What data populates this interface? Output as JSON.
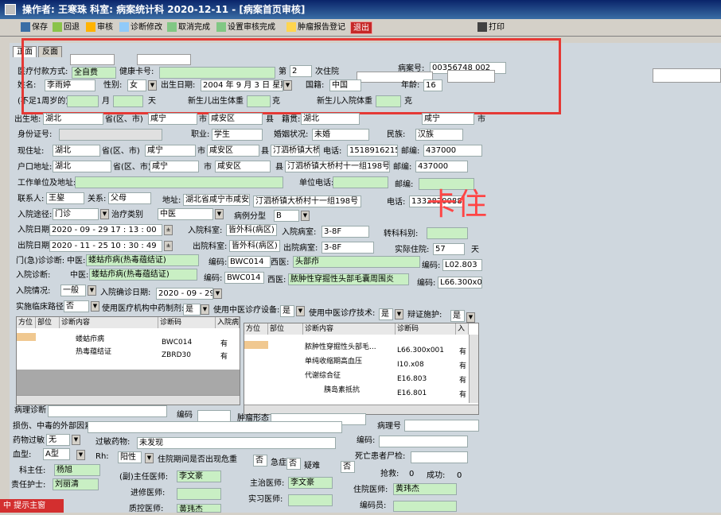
{
  "title": "操作者: 王寒珠   科室: 病案统计科   2020-12-11 - [病案首页审核]",
  "toolbar": {
    "save": "保存",
    "back": "回退",
    "audit": "审核",
    "diag_edit": "诊断修改",
    "cancel_done": "取消完成",
    "set_done": "设置审核完成",
    "tumor_reg": "肿瘤报告登记",
    "exit": "退出",
    "print": "打印"
  },
  "tabs": [
    "正面",
    "反面"
  ],
  "header": {
    "pay_label": "医疗付款方式:",
    "pay_value": "全自费",
    "health_card_label": "健康卡号:",
    "nth_label": "第",
    "nth_value": "2",
    "nth_suffix": "次住院",
    "case_no_label": "病案号:",
    "case_no_value": "00356748 002",
    "name_label": "姓名:",
    "name_value": "李雨婷",
    "sex_label": "性别:",
    "sex_value": "女",
    "birth_label": "出生日期:",
    "birth_value": "2004 年 9 月 3 日 星期五",
    "nation_label": "国籍:",
    "nation_value": "中国",
    "age_label": "年龄:",
    "age_value": "16",
    "infant_age_label": "(不足1周岁的)年龄",
    "month": "月",
    "day": "天",
    "newborn_weight_label": "新生儿出生体重",
    "gram": "克",
    "newborn_adm_label": "新生儿入院体重",
    "gram2": "克"
  },
  "birthplace": {
    "label": "出生地:",
    "prov": "湖北",
    "prov_suffix": "省(区、市)",
    "city": "咸宁",
    "city_suffix": "市",
    "county": "咸安区",
    "county_suffix": "县",
    "native_label": "籍贯:",
    "native_prov": "湖北",
    "native_city": "咸宁",
    "native_city_suffix": "市"
  },
  "id_row": {
    "label": "身份证号:",
    "job_label": "职业:",
    "job": "学生",
    "marry_label": "婚姻状况:",
    "marry": "未婚",
    "ethnic_label": "民族:",
    "ethnic": "汉族"
  },
  "current_addr": {
    "label": "现住址:",
    "prov": "湖北",
    "prov_suffix": "省(区、市)",
    "city": "咸宁",
    "city_suffix": "市",
    "county": "咸安区",
    "county_suffix": "县",
    "detail": "汀泗桥镇大桥村",
    "phone_label": "电话:",
    "phone": "15189162155",
    "zip_label": "邮编:",
    "zip": "437000"
  },
  "hukou": {
    "label": "户口地址:",
    "prov": "湖北",
    "prov_suffix": "省(区、市)",
    "city": "咸宁",
    "city_suffix": "市",
    "county": "咸安区",
    "county_suffix": "县",
    "detail": "汀泗桥镇大桥村十一组198号",
    "zip_label": "邮编:",
    "zip": "437000"
  },
  "work": {
    "label": "工作单位及地址:",
    "phone_label": "单位电话:",
    "zip_label": "邮编:"
  },
  "contact": {
    "label": "联系人:",
    "name": "王鋆",
    "rel_label": "关系:",
    "rel": "父母",
    "addr_label": "地址:",
    "addr1": "湖北省咸宁市咸安",
    "addr2": "汀泗桥镇大桥村十一组198号",
    "phone_label": "电话:",
    "phone": "13328200888"
  },
  "stamp": "卡住",
  "admission": {
    "route_label": "入院途径:",
    "route": "门诊",
    "treat_label": "治疗类别",
    "treat": "中医",
    "case_type_label": "病例分型",
    "case_type": "B",
    "in_date_label": "入院日期:",
    "in_date": "2020 - 09 - 29",
    "in_time": "17 : 13 : 00",
    "in_dept_label": "入院科室:",
    "in_dept": "皆外科(病区)",
    "in_ward_label": "入院病室:",
    "in_ward": "3-8F",
    "transfer_label": "转科科别:",
    "out_date_label": "出院日期:",
    "out_date": "2020 - 11 - 25",
    "out_time": "10 : 30 : 49",
    "out_dept_label": "出院科室:",
    "out_dept": "皆外科(病区)",
    "out_ward_label": "出院病室:",
    "out_ward": "3-8F",
    "days_label": "实际住院:",
    "days": "57",
    "days_suffix": "天"
  },
  "diagnosis": {
    "outpatient_label": "门(急)诊诊断:",
    "zy_label": "中医:",
    "op_zy": "蝼蛄疖病(热毒蕴结证)",
    "code_label": "编码:",
    "op_code": "BWC014",
    "xy_label": "西医:",
    "op_xy": "头部疖",
    "op_xy_code": "L02.803",
    "admit_label": "入院诊断:",
    "ad_zy": "蝼蛄疖病(热毒蕴结证)",
    "ad_code": "BWC014",
    "ad_xy": "脓肿性穿掘性头部毛囊周围炎",
    "ad_xy_code": "L66.300x0",
    "condition_label": "入院情况:",
    "condition": "一般",
    "confirm_label": "入院确诊日期:",
    "confirm_date": "2020 - 09 - 29",
    "pathway_label": "实施临床路径:",
    "pathway": "否",
    "tcm_prep_label": "使用医疗机构中药制剂:",
    "tcm_prep": "是",
    "tcm_equip_label": "使用中医诊疗设备:",
    "tcm_equip": "是",
    "tcm_tech_label": "使用中医诊疗技术:",
    "tcm_tech": "是",
    "care_label": "辩证施护:",
    "care": "是"
  },
  "left_grid": {
    "headers": [
      "方位",
      "部位",
      "诊断内容",
      "诊断码",
      "入院病"
    ],
    "rows": [
      [
        "",
        "",
        "蝼蛄疖病",
        "BWC014",
        "有"
      ],
      [
        "",
        "",
        "热毒蕴结证",
        "ZBRD30",
        "有"
      ]
    ]
  },
  "right_grid": {
    "headers": [
      "方位",
      "部位",
      "诊断内容",
      "诊断码",
      "入"
    ],
    "rows": [
      [
        "",
        "",
        "脓肿性穿掘性头部毛...",
        "L66.300x001",
        "有"
      ],
      [
        "",
        "",
        "单纯收缩期高血压",
        "I10.x08",
        "有"
      ],
      [
        "",
        "",
        "代谢综合征",
        "E16.803",
        "有"
      ],
      [
        "",
        "",
        "胰岛素抵抗",
        "E16.801",
        "有"
      ]
    ]
  },
  "bottom": {
    "pathology_label": "病理诊断",
    "code_label": "编码",
    "tumor_label": "肿瘤形态",
    "path_no_label": "病理号",
    "injury_label": "损伤、中毒的外部因素:",
    "code2_label": "编码:",
    "allergy_label": "药物过敏",
    "allergy": "无",
    "allergy_drug_label": "过敏药物:",
    "allergy_drug": "未发现",
    "code3_label": "编码:",
    "blood_label": "血型:",
    "blood": "A型",
    "rh_label": "Rh:",
    "rh": "阳性",
    "danger_label": "住院期间是否出现危重",
    "danger": "否",
    "emerg_label": "急症",
    "emerg": "否",
    "difficult_label": "疑难",
    "difficult": "否",
    "autopsy_label": "死亡患者尸检:",
    "rescue_label": "抢救:",
    "rescue": "0",
    "success_label": "成功:",
    "success": "0",
    "director_label": "科主任:",
    "director": "杨旭",
    "assoc_label": "(副)主任医师:",
    "assoc": "李文豪",
    "attending_label": "主治医师:",
    "attending": "李文豪",
    "resident_label": "住院医师:",
    "resident": "黄玮杰",
    "nurse_label": "责任护士:",
    "nurse": "刘丽清",
    "advanced_label": "进修医师:",
    "intern_label": "实习医师:",
    "coder_label": "编码员:",
    "qc_label": "质控医师:",
    "qc": "黄玮杰",
    "bottom_btn": "中 提示主窗"
  }
}
